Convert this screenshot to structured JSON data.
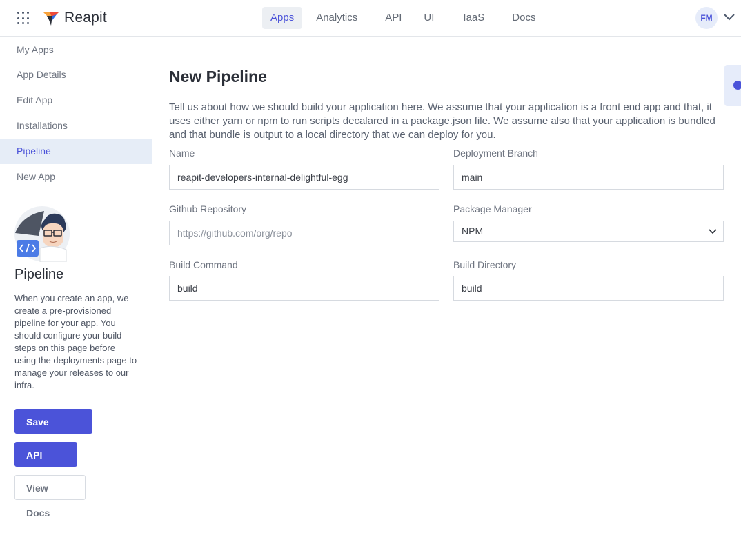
{
  "app": {
    "brand": "Reapit"
  },
  "topnav": {
    "items": [
      {
        "label": "Apps"
      },
      {
        "label": "Analytics"
      },
      {
        "label": "API"
      },
      {
        "label": "UI"
      },
      {
        "label": "IaaS"
      },
      {
        "label": "Docs"
      }
    ],
    "active": "Apps",
    "avatar_initials": "FM"
  },
  "sidebar": {
    "items": [
      {
        "label": "My Apps"
      },
      {
        "label": "App Details"
      },
      {
        "label": "Edit App"
      },
      {
        "label": "Installations"
      },
      {
        "label": "Pipeline"
      },
      {
        "label": "New App"
      }
    ],
    "active": "Pipeline",
    "panel": {
      "title": "Pipeline",
      "description": "When you create an app, we create a pre-provisioned pipeline for your app. You should configure your build steps on this page before using the deployments page to manage your releases to our infra.",
      "buttons": {
        "save": "Save Config",
        "api_keys": "API Keys",
        "view_docs": "View Docs"
      }
    }
  },
  "main": {
    "title": "New Pipeline",
    "intro": "Tell us about how we should build your application here. We assume that your application is a front end app and that, it uses either yarn or npm to run scripts decalared in a package.json file. We assume also that your application is bundled and that bundle is output to a local directory that we can deploy for you.",
    "form": {
      "name": {
        "label": "Name",
        "value": "reapit-developers-internal-delightful-egg"
      },
      "branch": {
        "label": "Deployment Branch",
        "value": "main"
      },
      "repo": {
        "label": "Github Repository",
        "value": "",
        "placeholder": "https://github.com/org/repo"
      },
      "package_manager": {
        "label": "Package Manager",
        "value": "NPM"
      },
      "build_command": {
        "label": "Build Command",
        "value": "build"
      },
      "build_directory": {
        "label": "Build Directory",
        "value": "build"
      }
    }
  },
  "colors": {
    "accent": "#4b53d9",
    "active_bg": "#e6edf7",
    "border": "#d6dae0"
  },
  "icons": [
    "apps-grid-icon",
    "reapit-logo-icon",
    "chevron-down-icon",
    "code-icon",
    "info-icon"
  ]
}
